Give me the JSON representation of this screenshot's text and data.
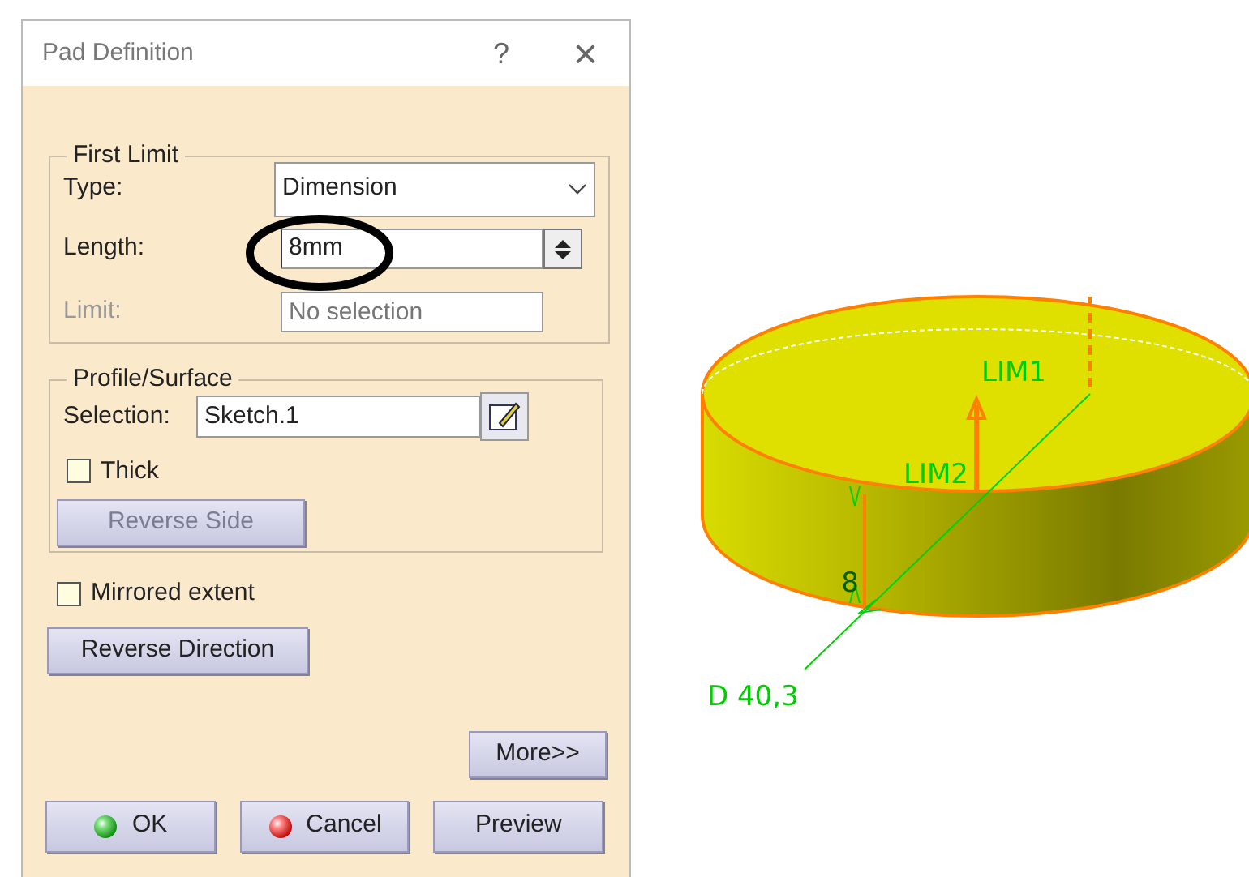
{
  "dialog": {
    "title": "Pad Definition",
    "help": "?",
    "close": "×"
  },
  "first_limit": {
    "title": "First Limit",
    "type": {
      "label": "Type:",
      "value": "Dimension"
    },
    "length": {
      "label": "Length:",
      "value": "8mm",
      "highlighted": true
    },
    "limit": {
      "label": "Limit:",
      "placeholder": "No selection",
      "disabled": true
    }
  },
  "profile": {
    "title": "Profile/Surface",
    "selection": {
      "label": "Selection:",
      "value": "Sketch.1"
    },
    "thick": {
      "label": "Thick",
      "checked": false
    },
    "reverse_side": {
      "label": "Reverse Side",
      "disabled": true
    }
  },
  "mirrored": {
    "label": "Mirrored extent",
    "checked": false
  },
  "reverse_direction": {
    "label": "Reverse Direction"
  },
  "more": {
    "label": "More>>"
  },
  "buttons": [
    {
      "label": "OK",
      "kind": "ok"
    },
    {
      "label": "Cancel",
      "kind": "cancel"
    },
    {
      "label": "Preview",
      "kind": "plain"
    }
  ],
  "viewport": {
    "labels": [
      {
        "text": "LIM1",
        "kind": "lim1"
      },
      {
        "text": "LIM2",
        "kind": "lim2"
      },
      {
        "text": "8",
        "kind": "height"
      },
      {
        "text": "D 40,3",
        "kind": "diameter"
      }
    ]
  }
}
